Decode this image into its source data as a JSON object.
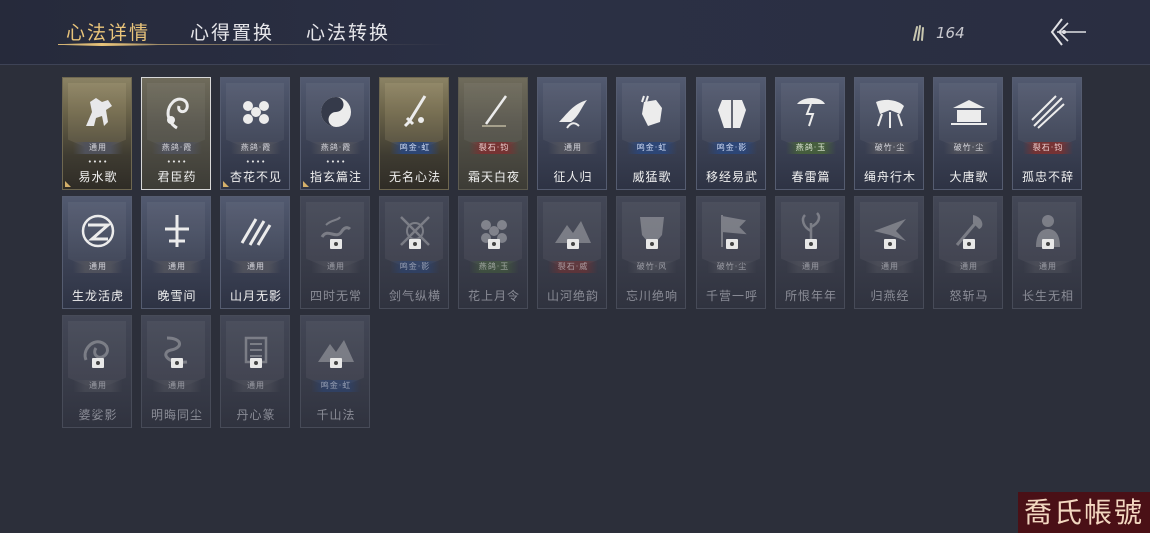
{
  "tabs": [
    {
      "label": "心法详情",
      "active": true
    },
    {
      "label": "心得置换",
      "active": false
    },
    {
      "label": "心法转换",
      "active": false
    }
  ],
  "currency": {
    "icon": "feather-icon",
    "value": "164"
  },
  "back_button": {
    "icon": "back-arrow-icon"
  },
  "watermark": "喬氏帳號",
  "colors": {
    "accent": "#e9c47a",
    "bg": "#2c2f3a"
  },
  "rows": [
    [
      {
        "name": "易水歌",
        "tag": "通用",
        "tag_color": "gray",
        "stars": "••••",
        "style": "gold",
        "art": "horse",
        "corner": true
      },
      {
        "name": "君臣药",
        "tag": "燕鸽·霞",
        "tag_color": "gray",
        "stars": "••••",
        "style": "olive",
        "art": "herb",
        "selected": true
      },
      {
        "name": "杏花不见",
        "tag": "燕鸽·霞",
        "tag_color": "gray",
        "stars": "••••",
        "style": "blue",
        "art": "flower",
        "corner": true
      },
      {
        "name": "指玄篇注",
        "tag": "燕鸽·霞",
        "tag_color": "gray",
        "stars": "••••",
        "style": "blue",
        "art": "yinyang",
        "corner": true
      },
      {
        "name": "无名心法",
        "tag": "鸣金·虹",
        "tag_color": "blue",
        "style": "gold",
        "art": "sword"
      },
      {
        "name": "霜天白夜",
        "tag": "裂石·钧",
        "tag_color": "red",
        "style": "olive",
        "art": "blade"
      },
      {
        "name": "征人归",
        "tag": "通用",
        "tag_color": "gray",
        "style": "blue",
        "art": "bird"
      },
      {
        "name": "威猛歌",
        "tag": "鸣金·虹",
        "tag_color": "blue",
        "style": "blue",
        "art": "fist"
      },
      {
        "name": "移经易武",
        "tag": "鸣金·影",
        "tag_color": "blue",
        "style": "blue",
        "art": "armor"
      },
      {
        "name": "春雷篇",
        "tag": "燕鸽·玉",
        "tag_color": "green",
        "style": "blue",
        "art": "thunder"
      },
      {
        "name": "绳舟行木",
        "tag": "破竹·尘",
        "tag_color": "gray",
        "style": "blue",
        "art": "roots"
      },
      {
        "name": "大唐歌",
        "tag": "破竹·尘",
        "tag_color": "gray",
        "style": "blue",
        "art": "palace"
      },
      {
        "name": "孤忠不辞",
        "tag": "裂石·钧",
        "tag_color": "red",
        "style": "blue",
        "art": "spears"
      }
    ],
    [
      {
        "name": "生龙活虎",
        "tag": "通用",
        "tag_color": "gray",
        "style": "blue",
        "art": "swirl"
      },
      {
        "name": "晚雪间",
        "tag": "通用",
        "tag_color": "gray",
        "style": "blue",
        "art": "cross"
      },
      {
        "name": "山月无影",
        "tag": "通用",
        "tag_color": "gray",
        "style": "blue",
        "art": "slash"
      },
      {
        "name": "四时无常",
        "tag": "通用",
        "tag_color": "gray",
        "style": "locked",
        "art": "wave"
      },
      {
        "name": "剑气纵横",
        "tag": "鸣金·影",
        "tag_color": "blue",
        "style": "locked",
        "art": "swords"
      },
      {
        "name": "花上月令",
        "tag": "燕鸽·玉",
        "tag_color": "green",
        "style": "locked",
        "art": "flower"
      },
      {
        "name": "山河绝韵",
        "tag": "裂石·威",
        "tag_color": "red",
        "style": "locked",
        "art": "mountain"
      },
      {
        "name": "忘川绝响",
        "tag": "破竹·风",
        "tag_color": "gray",
        "style": "locked",
        "art": "mask"
      },
      {
        "name": "千营一呼",
        "tag": "破竹·尘",
        "tag_color": "gray",
        "style": "locked",
        "art": "flag"
      },
      {
        "name": "所恨年年",
        "tag": "通用",
        "tag_color": "gray",
        "style": "locked",
        "art": "plant"
      },
      {
        "name": "归燕经",
        "tag": "通用",
        "tag_color": "gray",
        "style": "locked",
        "art": "swallow"
      },
      {
        "name": "怒斩马",
        "tag": "通用",
        "tag_color": "gray",
        "style": "locked",
        "art": "axe"
      },
      {
        "name": "长生无相",
        "tag": "通用",
        "tag_color": "gray",
        "style": "locked",
        "art": "buddha"
      }
    ],
    [
      {
        "name": "婆娑影",
        "tag": "通用",
        "tag_color": "gray",
        "style": "locked",
        "art": "dragon"
      },
      {
        "name": "明晦同尘",
        "tag": "通用",
        "tag_color": "gray",
        "style": "locked",
        "art": "snake"
      },
      {
        "name": "丹心篆",
        "tag": "通用",
        "tag_color": "gray",
        "style": "locked",
        "art": "seal"
      },
      {
        "name": "千山法",
        "tag": "鸣金·虹",
        "tag_color": "blue",
        "style": "locked",
        "art": "mountain"
      }
    ]
  ]
}
